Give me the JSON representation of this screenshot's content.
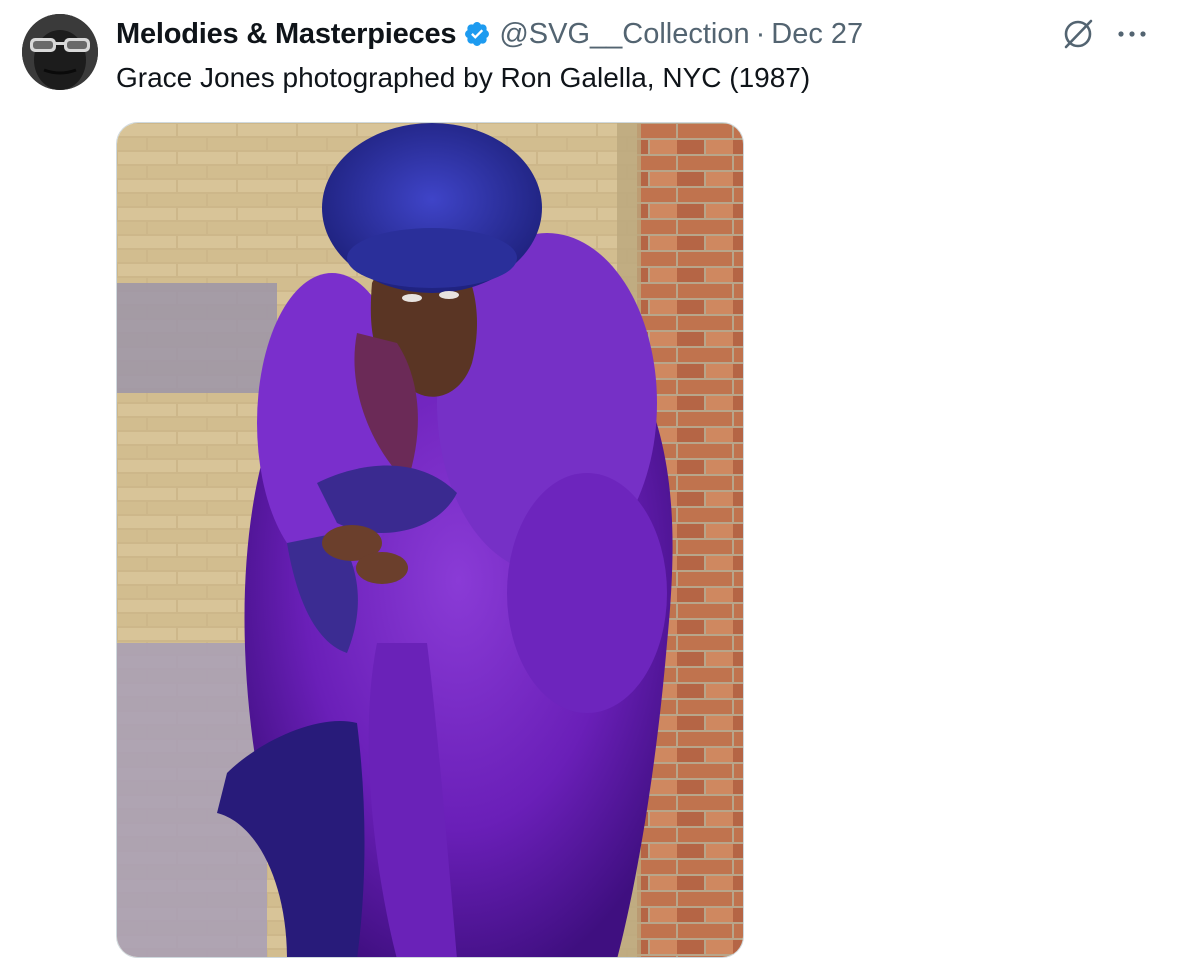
{
  "tweet": {
    "author": {
      "display_name": "Melodies & Masterpieces",
      "handle": "@SVG__Collection",
      "verified": true,
      "avatar_icon": "avatar-photo"
    },
    "separator": "·",
    "date": "Dec 27",
    "text": "Grace Jones photographed by Ron Galella, NYC (1987)",
    "media": {
      "type": "photo",
      "alt": "Grace Jones in a purple fur coat and hat leaning against a brick wall"
    },
    "icons": {
      "verified": "verified-badge-icon",
      "grok": "grok-icon",
      "more": "more-icon"
    }
  },
  "colors": {
    "text_primary": "#0f1419",
    "text_secondary": "#536471",
    "verified_blue": "#1d9bf0",
    "media_border": "#cfd9de"
  }
}
